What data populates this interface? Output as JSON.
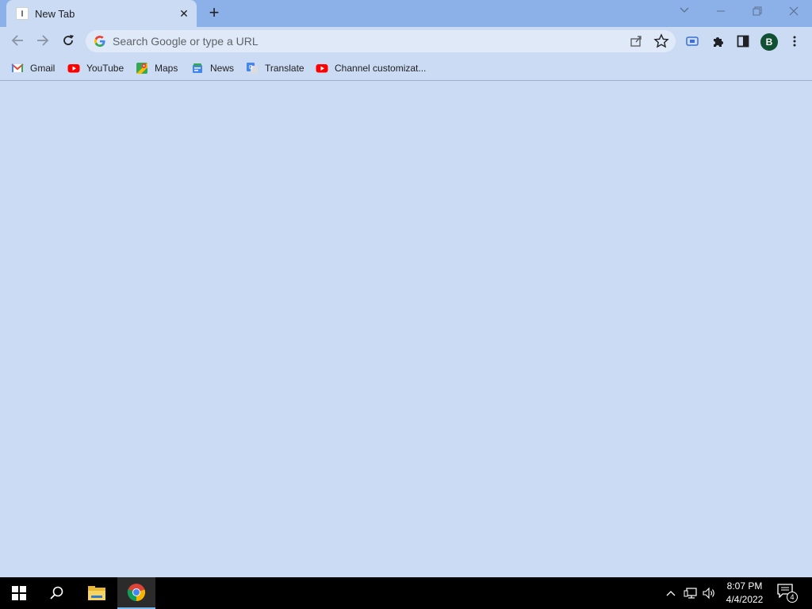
{
  "browser": {
    "tab": {
      "title": "New Tab"
    },
    "omnibox": {
      "placeholder": "Search Google or type a URL"
    },
    "profile_initial": "B",
    "accent_color": "#8cb0e8",
    "page_color": "#cadbf3"
  },
  "bookmarks": [
    {
      "label": "Gmail",
      "icon": "gmail-icon"
    },
    {
      "label": "YouTube",
      "icon": "youtube-icon"
    },
    {
      "label": "Maps",
      "icon": "maps-icon"
    },
    {
      "label": "News",
      "icon": "news-icon"
    },
    {
      "label": "Translate",
      "icon": "translate-icon"
    },
    {
      "label": "Channel customizat...",
      "icon": "youtube-icon"
    }
  ],
  "taskbar": {
    "time": "8:07 PM",
    "date": "4/4/2022",
    "notification_count": "4",
    "apps": [
      "start",
      "search",
      "file-explorer",
      "chrome"
    ]
  }
}
